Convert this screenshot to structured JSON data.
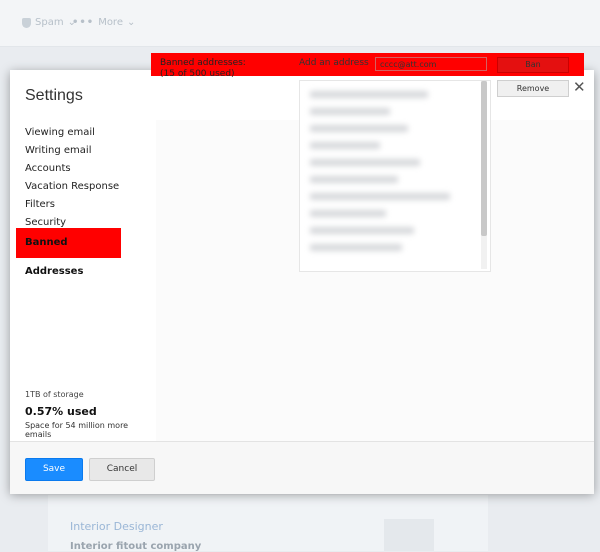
{
  "background": {
    "toolbar": {
      "spam_label": "Spam",
      "more_label": "More"
    },
    "card": {
      "title": "Interior Designer",
      "subtitle": "Interior fitout company"
    }
  },
  "modal": {
    "title": "Settings",
    "close_icon": "✕",
    "nav": [
      "Viewing email",
      "Writing email",
      "Accounts",
      "Vacation Response",
      "Filters",
      "Security",
      "Banned Addresses"
    ],
    "active_nav": "Banned Addresses",
    "storage": {
      "capacity": "1TB of storage",
      "used": "0.57% used",
      "space": "Space for 54 million more emails"
    },
    "banned": {
      "label": "Banned addresses:",
      "count": "(15 of 500 used)",
      "add_label": "Add an address",
      "input_value": "cccc@att.com",
      "ban_button": "Ban",
      "remove_button": "Remove"
    },
    "footer": {
      "save": "Save",
      "cancel": "Cancel"
    }
  },
  "colors": {
    "highlight": "#ff0000",
    "primary": "#1a8cff"
  }
}
